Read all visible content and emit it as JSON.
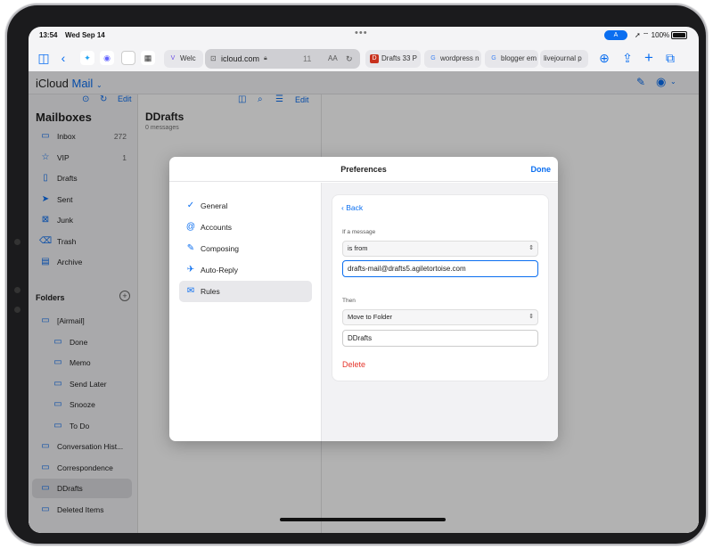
{
  "status_bar": {
    "time": "13:54",
    "date": "Wed Sep 14",
    "system_text": "100%"
  },
  "browser": {
    "url": "icloud.com",
    "tab_count_badge": "11",
    "reader_label": "AA",
    "tabs": [
      {
        "label": "Welc",
        "favicon": "V"
      },
      {
        "label": "Drafts 33 P",
        "favicon": "D"
      },
      {
        "label": "wordpress n",
        "favicon": "G"
      },
      {
        "label": "blogger em",
        "favicon": "G"
      },
      {
        "label": "livejournal p",
        "favicon": ""
      }
    ]
  },
  "app": {
    "brand_icloud": "iCloud",
    "brand_mail": "Mail"
  },
  "sidebar": {
    "edit_label": "Edit",
    "title": "Mailboxes",
    "mailboxes": [
      {
        "label": "Inbox",
        "count": "272",
        "icon": "inbox-icon",
        "glyph": "▭"
      },
      {
        "label": "VIP",
        "count": "1",
        "icon": "star-icon",
        "glyph": "☆"
      },
      {
        "label": "Drafts",
        "count": "",
        "icon": "document-icon",
        "glyph": "▯"
      },
      {
        "label": "Sent",
        "count": "",
        "icon": "paperplane-icon",
        "glyph": "➤"
      },
      {
        "label": "Junk",
        "count": "",
        "icon": "junk-icon",
        "glyph": "⊠"
      },
      {
        "label": "Trash",
        "count": "",
        "icon": "trash-icon",
        "glyph": "⌫"
      },
      {
        "label": "Archive",
        "count": "",
        "icon": "archive-icon",
        "glyph": "▤"
      }
    ],
    "folders_heading": "Folders",
    "folders": [
      {
        "label": "[Airmail]"
      },
      {
        "label": "Done"
      },
      {
        "label": "Memo"
      },
      {
        "label": "Send Later"
      },
      {
        "label": "Snooze"
      },
      {
        "label": "To Do"
      },
      {
        "label": "Conversation Hist..."
      },
      {
        "label": "Correspondence"
      },
      {
        "label": "DDrafts"
      },
      {
        "label": "Deleted Items"
      }
    ]
  },
  "message_list": {
    "title": "DDrafts",
    "subtitle": "0 messages",
    "edit_label": "Edit"
  },
  "modal": {
    "title": "Preferences",
    "done_label": "Done",
    "nav": [
      {
        "label": "General",
        "icon": "checkmark-circle-icon",
        "glyph": "✓"
      },
      {
        "label": "Accounts",
        "icon": "at-sign-icon",
        "glyph": "@"
      },
      {
        "label": "Composing",
        "icon": "compose-icon",
        "glyph": "✎"
      },
      {
        "label": "Auto-Reply",
        "icon": "airplane-icon",
        "glyph": "✈"
      },
      {
        "label": "Rules",
        "icon": "envelope-rules-icon",
        "glyph": "✉"
      }
    ],
    "rule": {
      "back_label": "Back",
      "condition_label": "If a message",
      "condition_value": "is from",
      "condition_input": "drafts-mail@drafts5.agiletortoise.com",
      "action_label": "Then",
      "action_value": "Move to Folder",
      "action_input": "DDrafts",
      "delete_label": "Delete"
    }
  }
}
